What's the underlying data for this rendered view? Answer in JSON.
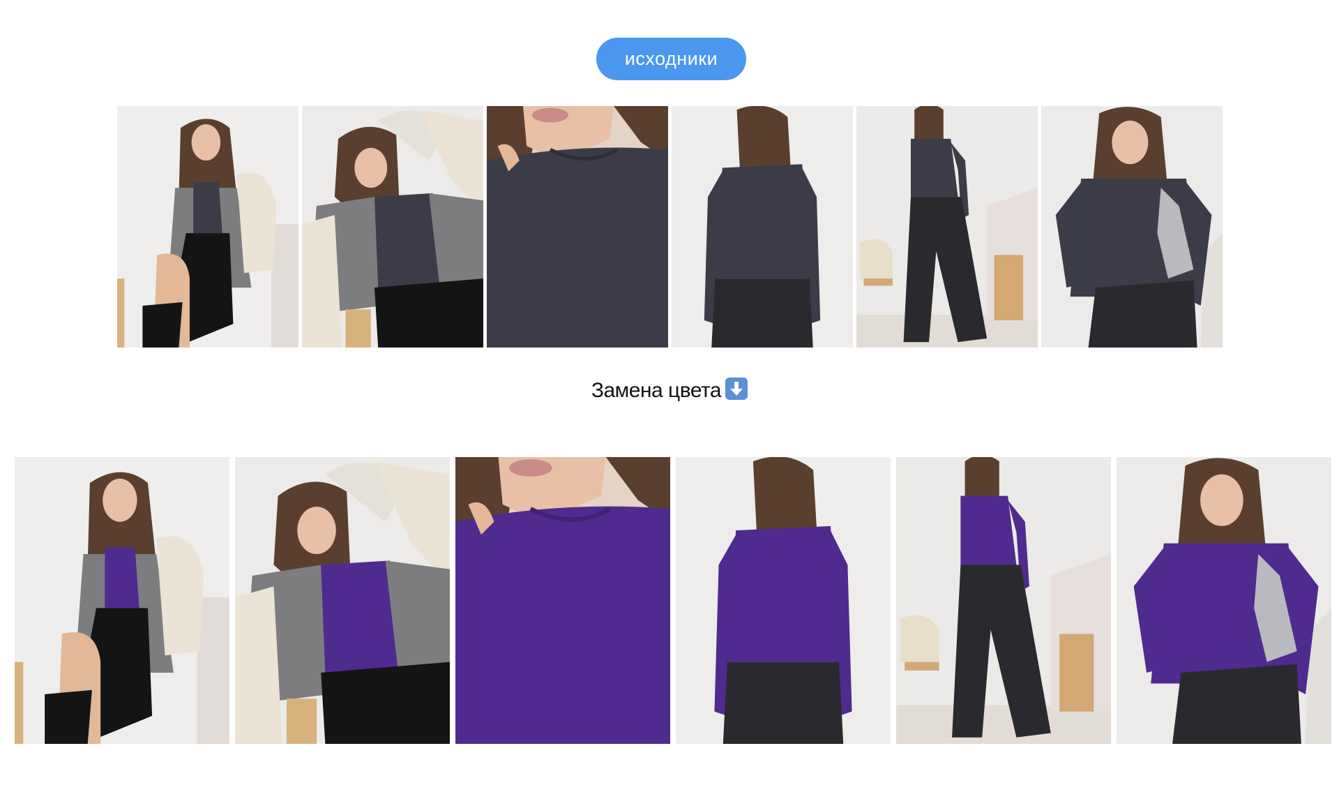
{
  "header": {
    "button_label": "исходники"
  },
  "caption": {
    "text": "Замена цвета"
  },
  "colors": {
    "button": "#4c97ef",
    "original_top": "#3b3c48",
    "recolored_top": "#4f2a8f"
  },
  "icons": {
    "caption_icon": "down-arrow-icon"
  },
  "original_photos": [
    {
      "name": "photo-bomber-seated-original"
    },
    {
      "name": "photo-bomber-arm-raised-original"
    },
    {
      "name": "photo-closeup-neckline-original"
    },
    {
      "name": "photo-back-view-original"
    },
    {
      "name": "photo-full-length-jeans-original"
    },
    {
      "name": "photo-bag-pose-original"
    }
  ],
  "recolored_photos": [
    {
      "name": "photo-bomber-seated-recolored"
    },
    {
      "name": "photo-bomber-arm-raised-recolored"
    },
    {
      "name": "photo-closeup-neckline-recolored"
    },
    {
      "name": "photo-back-view-recolored"
    },
    {
      "name": "photo-full-length-jeans-recolored"
    },
    {
      "name": "photo-bag-pose-recolored"
    }
  ]
}
